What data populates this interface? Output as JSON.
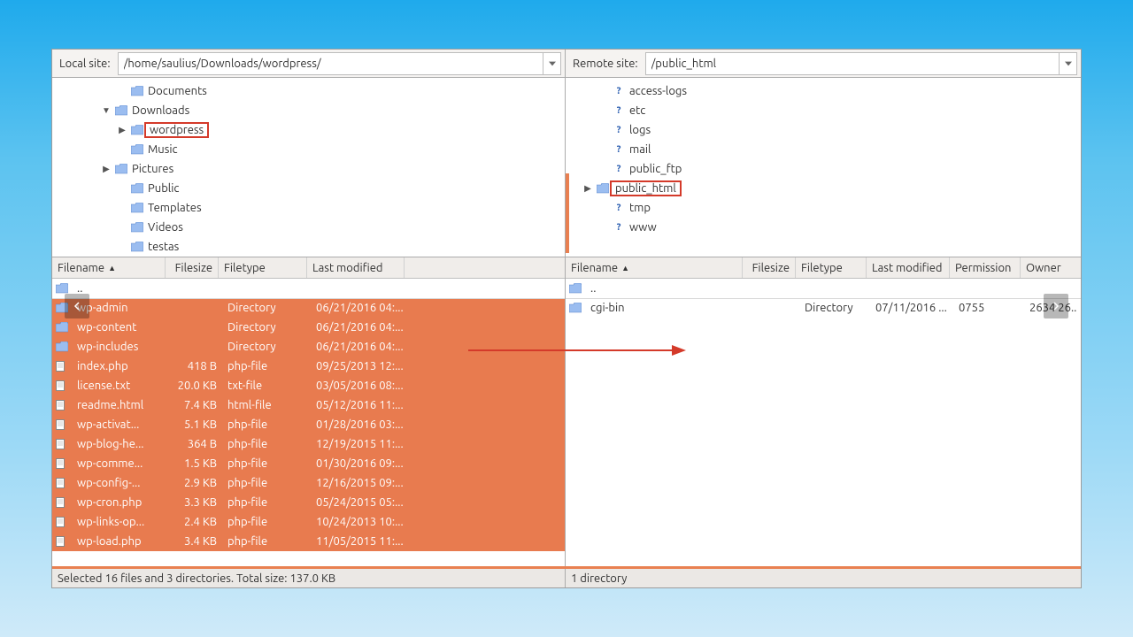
{
  "local": {
    "site_label": "Local site:",
    "path": "/home/saulius/Downloads/wordpress/",
    "tree": [
      {
        "indent": 4,
        "twisty": "",
        "kind": "folder",
        "label": "Documents"
      },
      {
        "indent": 3,
        "twisty": "▼",
        "kind": "folder",
        "label": "Downloads"
      },
      {
        "indent": 4,
        "twisty": "▶",
        "kind": "folder",
        "label": "wordpress",
        "highlight": true
      },
      {
        "indent": 4,
        "twisty": "",
        "kind": "folder",
        "label": "Music"
      },
      {
        "indent": 3,
        "twisty": "▶",
        "kind": "folder",
        "label": "Pictures"
      },
      {
        "indent": 4,
        "twisty": "",
        "kind": "folder",
        "label": "Public"
      },
      {
        "indent": 4,
        "twisty": "",
        "kind": "folder",
        "label": "Templates"
      },
      {
        "indent": 4,
        "twisty": "",
        "kind": "folder",
        "label": "Videos"
      },
      {
        "indent": 4,
        "twisty": "",
        "kind": "folder",
        "label": "testas"
      }
    ],
    "cols": {
      "name": "Filename",
      "size": "Filesize",
      "type": "Filetype",
      "mod": "Last modified"
    },
    "colw": {
      "name": 128,
      "size": 60,
      "type": 100,
      "mod": 110
    },
    "parent_label": "..",
    "files": [
      {
        "sel": true,
        "kind": "dir",
        "name": "wp-admin",
        "size": "",
        "type": "Directory",
        "mod": "06/21/2016 04:..."
      },
      {
        "sel": true,
        "kind": "dir",
        "name": "wp-content",
        "size": "",
        "type": "Directory",
        "mod": "06/21/2016 04:..."
      },
      {
        "sel": true,
        "kind": "dir",
        "name": "wp-includes",
        "size": "",
        "type": "Directory",
        "mod": "06/21/2016 04:..."
      },
      {
        "sel": true,
        "kind": "file",
        "name": "index.php",
        "size": "418 B",
        "type": "php-file",
        "mod": "09/25/2013 12:..."
      },
      {
        "sel": true,
        "kind": "file",
        "name": "license.txt",
        "size": "20.0 KB",
        "type": "txt-file",
        "mod": "03/05/2016 08:..."
      },
      {
        "sel": true,
        "kind": "file",
        "name": "readme.html",
        "size": "7.4 KB",
        "type": "html-file",
        "mod": "05/12/2016 11:..."
      },
      {
        "sel": true,
        "kind": "file",
        "name": "wp-activat...",
        "size": "5.1 KB",
        "type": "php-file",
        "mod": "01/28/2016 03:..."
      },
      {
        "sel": true,
        "kind": "file",
        "name": "wp-blog-he...",
        "size": "364 B",
        "type": "php-file",
        "mod": "12/19/2015 11:..."
      },
      {
        "sel": true,
        "kind": "file",
        "name": "wp-comme...",
        "size": "1.5 KB",
        "type": "php-file",
        "mod": "01/30/2016 09:..."
      },
      {
        "sel": true,
        "kind": "file",
        "name": "wp-config-...",
        "size": "2.9 KB",
        "type": "php-file",
        "mod": "12/16/2015 09:..."
      },
      {
        "sel": true,
        "kind": "file",
        "name": "wp-cron.php",
        "size": "3.3 KB",
        "type": "php-file",
        "mod": "05/24/2015 05:..."
      },
      {
        "sel": true,
        "kind": "file",
        "name": "wp-links-op...",
        "size": "2.4 KB",
        "type": "php-file",
        "mod": "10/24/2013 10:..."
      },
      {
        "sel": true,
        "kind": "file",
        "name": "wp-load.php",
        "size": "3.4 KB",
        "type": "php-file",
        "mod": "11/05/2015 11:..."
      }
    ],
    "status": "Selected 16 files and 3 directories. Total size: 137.0 KB"
  },
  "remote": {
    "site_label": "Remote site:",
    "path": "/public_html",
    "tree": [
      {
        "indent": 2,
        "twisty": "",
        "kind": "q",
        "label": "access-logs"
      },
      {
        "indent": 2,
        "twisty": "",
        "kind": "q",
        "label": "etc"
      },
      {
        "indent": 2,
        "twisty": "",
        "kind": "q",
        "label": "logs"
      },
      {
        "indent": 2,
        "twisty": "",
        "kind": "q",
        "label": "mail"
      },
      {
        "indent": 2,
        "twisty": "",
        "kind": "q",
        "label": "public_ftp"
      },
      {
        "indent": 1,
        "twisty": "▶",
        "kind": "folder",
        "label": "public_html",
        "highlight": true
      },
      {
        "indent": 2,
        "twisty": "",
        "kind": "q",
        "label": "tmp"
      },
      {
        "indent": 2,
        "twisty": "",
        "kind": "q",
        "label": "www"
      }
    ],
    "cols": {
      "name": "Filename",
      "size": "Filesize",
      "type": "Filetype",
      "mod": "Last modified",
      "perm": "Permission",
      "owner": "Owner"
    },
    "colw": {
      "name": 200,
      "size": 60,
      "type": 80,
      "mod": 94,
      "perm": 80,
      "owner": 60
    },
    "parent_label": "..",
    "files": [
      {
        "sel": false,
        "kind": "dir",
        "name": "cgi-bin",
        "size": "",
        "type": "Directory",
        "mod": "07/11/2016 ...",
        "perm": "0755",
        "owner": "2634 26..."
      }
    ],
    "status": "1 directory"
  }
}
